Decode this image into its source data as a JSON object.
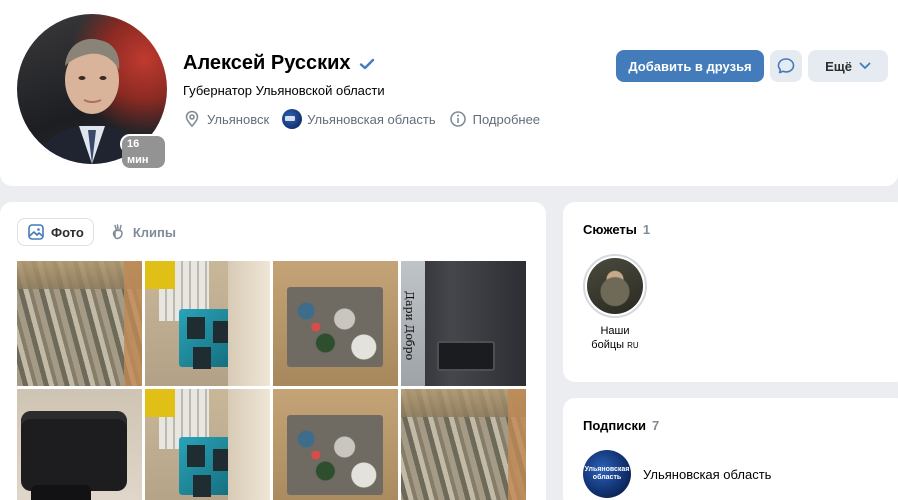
{
  "profile": {
    "name": "Алексей Русских",
    "status": "Губернатор Ульяновской области",
    "online_badge": "16 мин",
    "city": "Ульяновск",
    "region": "Ульяновская область",
    "more_info": "Подробнее",
    "verified": true
  },
  "actions": {
    "add_friend": "Добавить в друзья",
    "more": "Ещё"
  },
  "photos": {
    "tabs": [
      {
        "label": "Фото",
        "active": true
      },
      {
        "label": "Клипы",
        "active": false
      }
    ],
    "stove_text": "Дари Добро"
  },
  "stories": {
    "title": "Сюжеты",
    "count": "1",
    "items": [
      {
        "label_line1": "Наши",
        "label_line2": "бойцы",
        "suffix": "RU"
      }
    ]
  },
  "subscriptions": {
    "title": "Подписки",
    "count": "7",
    "items": [
      {
        "name": "Ульяновская область",
        "logo_text": "Ульяновская область"
      }
    ]
  },
  "colors": {
    "primary": "#447bba",
    "secondary_button": "#e5ebf1",
    "muted_text": "#818c99",
    "background": "#ebedf0"
  }
}
